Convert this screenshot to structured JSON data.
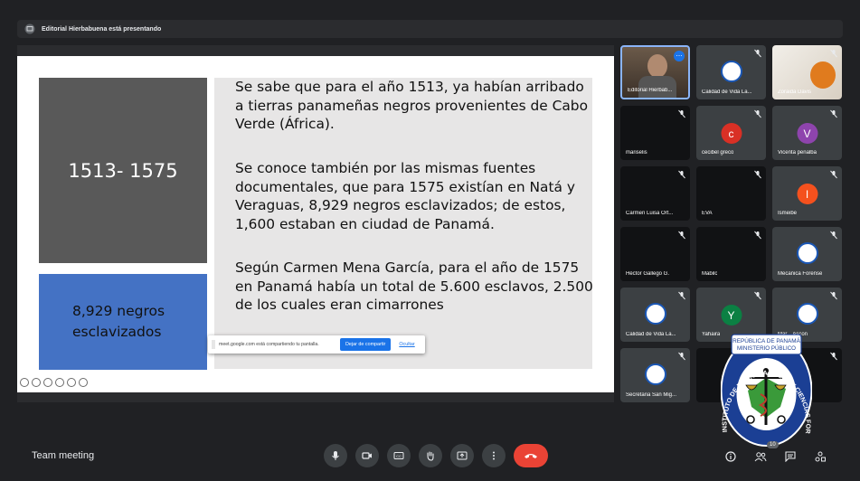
{
  "presenting_banner": "Editorial Hierbabuena está presentando",
  "slide": {
    "left_box_top": "1513- 1575",
    "left_box_bottom": "8,929 negros\nesclavizados",
    "paragraphs": [
      "Se sabe que para el año 1513, ya habían arribado a tierras panameñas negros provenientes de Cabo Verde (África).",
      "Se conoce también por las mismas fuentes documentales, que para 1575 existían en Natá y Veraguas, 8,929 negros esclavizados; de estos, 1,600 estaban en ciudad de Panamá.",
      "Según Carmen Mena García, para el año de 1575 en Panamá había un total de 5.600 esclavos, 2.500 de los cuales eran cimarrones"
    ]
  },
  "share_bar": {
    "message": "meet.google.com está compartiendo tu pantalla.",
    "stop_label": "Dejar de compartir",
    "hide_label": "Ocultar"
  },
  "participants": [
    {
      "name": "Editorial Hierbab...",
      "type": "video-person"
    },
    {
      "name": "Calidad de Vida La...",
      "type": "logo"
    },
    {
      "name": "Zoraida Davis",
      "type": "video-light"
    },
    {
      "name": "mariselis",
      "type": "dark"
    },
    {
      "name": "cecibel greco",
      "type": "avatar",
      "initial": "c",
      "color": "#d93025"
    },
    {
      "name": "Vicenta peñalba",
      "type": "avatar",
      "initial": "V",
      "color": "#8e44ad"
    },
    {
      "name": "Carmen Luisa Ort...",
      "type": "dark"
    },
    {
      "name": "EVA",
      "type": "dark"
    },
    {
      "name": "Ismeibe",
      "type": "avatar",
      "initial": "I",
      "color": "#f4511e"
    },
    {
      "name": "Héctor Gallego G.",
      "type": "dark"
    },
    {
      "name": "Mabilc",
      "type": "dark"
    },
    {
      "name": "Mecanica Forense",
      "type": "logo"
    },
    {
      "name": "Calidad de Vida La...",
      "type": "logo"
    },
    {
      "name": "Yahaira",
      "type": "avatar",
      "initial": "Y",
      "color": "#0b8043"
    },
    {
      "name": "Mar... Ascon",
      "type": "logo"
    },
    {
      "name": "Secretaria San Mig...",
      "type": "logo"
    },
    {
      "name": "",
      "type": "dark"
    },
    {
      "name": "",
      "type": "dark"
    }
  ],
  "seal": {
    "top1": "REPÚBLICA DE PANAMÁ",
    "top2": "MINISTERIO PÚBLICO",
    "ring_text": "INSTITUTO DE MEDICINA LEGAL Y CIENCIAS FORENSES"
  },
  "bottom": {
    "meeting_name": "Team meeting",
    "participant_count": "10"
  },
  "colors": {
    "end_call": "#ea4335",
    "accent": "#1a73e8",
    "slide_gray": "#595959",
    "slide_blue": "#4472c4"
  },
  "icons": [
    "mic-icon",
    "camera-icon",
    "captions-icon",
    "raise-hand-icon",
    "present-icon",
    "more-options-icon",
    "end-call-icon",
    "info-icon",
    "people-icon",
    "chat-icon",
    "activities-icon"
  ]
}
